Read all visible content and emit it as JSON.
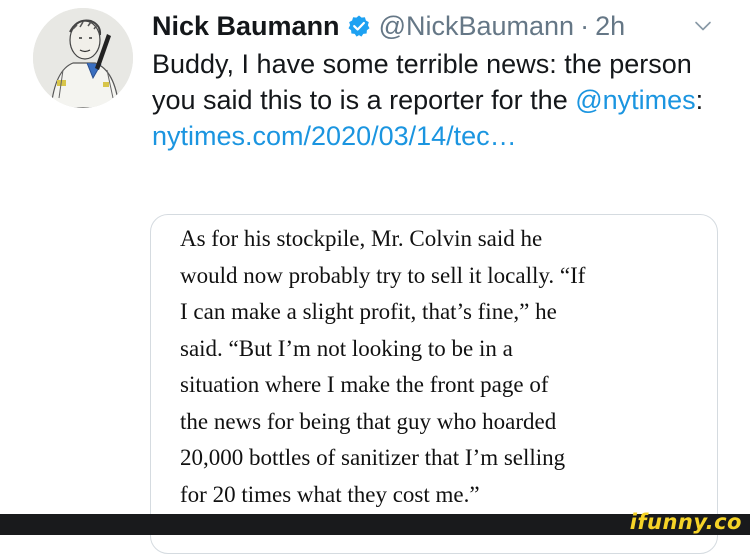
{
  "tweet": {
    "author_name": "Nick Baumann",
    "handle": "@NickBaumann",
    "separator": "·",
    "time": "2h",
    "text_before_mention": "Buddy, I have some terrible news: the person you said this to is a reporter for the ",
    "mention": "@nytimes",
    "text_after_mention": ": ",
    "link_text": "nytimes.com/2020/03/14/​tec…"
  },
  "quote": {
    "lines": [
      "As for his stockpile, Mr. Colvin said he",
      "would now probably try to sell it locally. “If",
      "I can make a slight profit, that’s fine,” he",
      "said. “But I’m not looking to be in a",
      "situation where I make the front page of",
      "the news for being that guy who hoarded",
      "20,000 bottles of sanitizer that I’m selling",
      "for 20 times what they cost me.”"
    ]
  },
  "watermark": "ifunny.co",
  "icons": {
    "verified": "verified-badge-icon",
    "caret": "chevron-down-icon"
  },
  "colors": {
    "link": "#1b95e0",
    "secondary_text": "#657786",
    "verified": "#1da1f2",
    "watermark": "#f5d327"
  }
}
